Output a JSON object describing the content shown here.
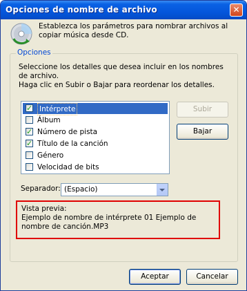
{
  "window": {
    "title": "Opciones de nombre de archivo",
    "close_symbol": "✕"
  },
  "header": {
    "icon": "cd-burn-icon",
    "text": "Establezca los parámetros para nombrar archivos al copiar música desde CD."
  },
  "options_group": {
    "legend": "Opciones",
    "instruction_1": "Seleccione los detalles que desea incluir en los nombres de archivo.",
    "instruction_2": "Haga clic en Subir o Bajar para reordenar los detalles."
  },
  "details": [
    {
      "label": "Intérprete",
      "checked": true,
      "selected": true
    },
    {
      "label": "Álbum",
      "checked": false,
      "selected": false
    },
    {
      "label": "Número de pista",
      "checked": true,
      "selected": false
    },
    {
      "label": "Título de la canción",
      "checked": true,
      "selected": false
    },
    {
      "label": "Género",
      "checked": false,
      "selected": false
    },
    {
      "label": "Velocidad de bits",
      "checked": false,
      "selected": false
    }
  ],
  "buttons": {
    "up": "Subir",
    "down": "Bajar",
    "ok": "Aceptar",
    "cancel": "Cancelar"
  },
  "separator": {
    "label": "Separador:",
    "value": "(Espacio)"
  },
  "preview": {
    "label": "Vista previa:",
    "text": "Ejemplo de nombre de intérprete 01 Ejemplo de nombre de canción.MP3",
    "highlight_color": "#e00000"
  },
  "colors": {
    "titlebar": "#0556dc",
    "selection": "#316ac5",
    "dialog_bg": "#ece9d8"
  }
}
